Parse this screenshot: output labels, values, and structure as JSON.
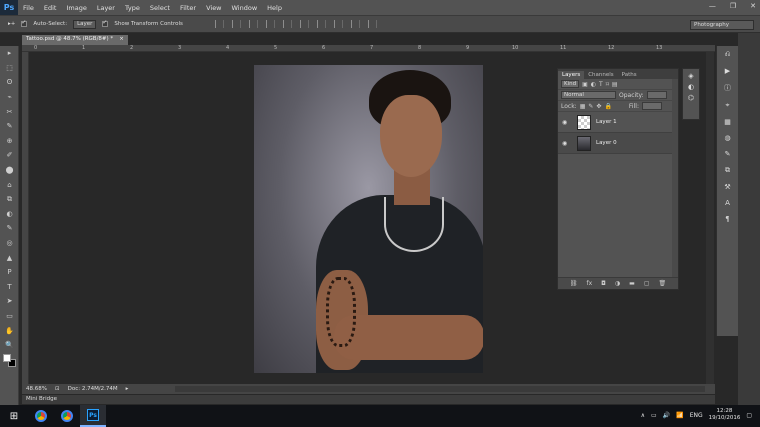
{
  "app": {
    "logo": "Ps"
  },
  "menu": [
    "File",
    "Edit",
    "Image",
    "Layer",
    "Type",
    "Select",
    "Filter",
    "View",
    "Window",
    "Help"
  ],
  "window_controls": [
    "—",
    "❐",
    "✕"
  ],
  "options": {
    "move_icon": "▸+",
    "auto_select_label": "Auto-Select:",
    "auto_select_value": "Layer",
    "show_transform_label": "Show Transform Controls",
    "workspace": "Photography"
  },
  "document": {
    "tab_title": "Tattoo.psd @ 48.7% (RGB/8#) *",
    "tab_close": "×",
    "zoom": "48.68%",
    "doc_info": "Doc: 2.74M/2.74M",
    "ruler_ticks": [
      "0",
      "1",
      "2",
      "3",
      "4",
      "5",
      "6",
      "7",
      "8",
      "9",
      "10",
      "11",
      "12",
      "13"
    ]
  },
  "tools": [
    "▸",
    "⬚",
    "ʘ",
    "⌁",
    "✂",
    "✎",
    "⊕",
    "✐",
    "⬤",
    "⌂",
    "⧉",
    "◐",
    "✎",
    "◎",
    "▲",
    "P",
    "T",
    "➤",
    "▭",
    "✋",
    "🔍"
  ],
  "layers_panel": {
    "tabs": [
      "Layers",
      "Channels",
      "Paths"
    ],
    "kind_label": "Kind",
    "blend_mode": "Normal",
    "opacity_label": "Opacity:",
    "lock_label": "Lock:",
    "fill_label": "Fill:",
    "layers": [
      {
        "name": "Layer 1",
        "thumb": "transparent",
        "selected": false
      },
      {
        "name": "Layer 0",
        "thumb": "photo",
        "selected": true
      }
    ],
    "footer_icons": [
      "⛓",
      "fx",
      "◘",
      "◑",
      "▬",
      "▢",
      "🗑"
    ]
  },
  "mini_bridge": {
    "label": "Mini Bridge"
  },
  "taskbar": {
    "start_icon": "⊞",
    "tray_icons": [
      "∧",
      "▭",
      "🔊",
      "📶"
    ],
    "language": "ENG",
    "time": "12:28",
    "date": "19/10/2016",
    "notification_icon": "▢"
  }
}
